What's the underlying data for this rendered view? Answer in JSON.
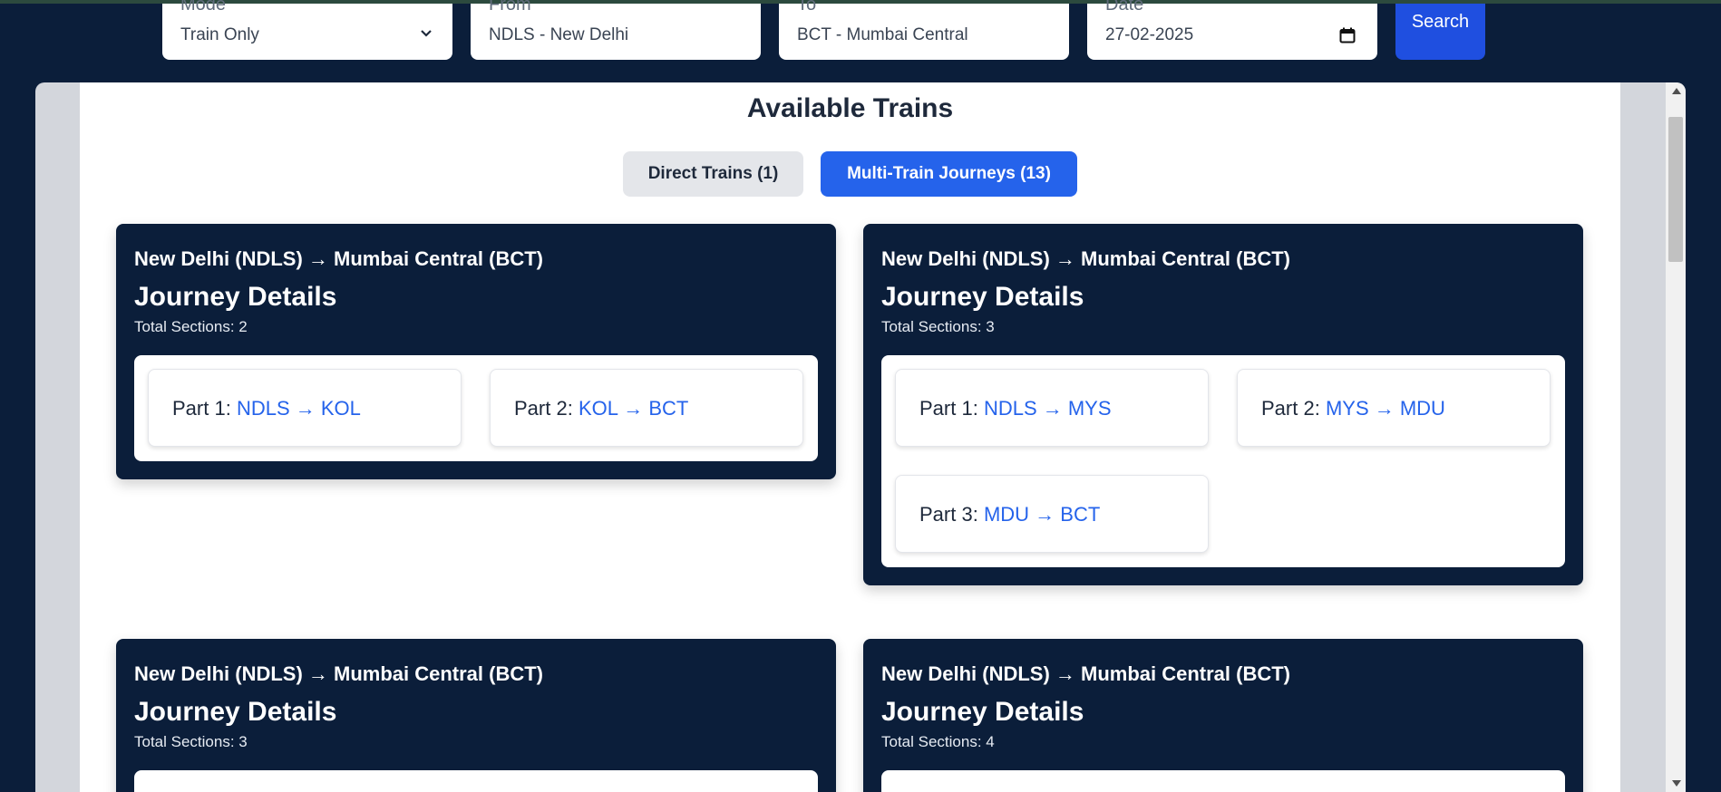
{
  "search": {
    "mode": {
      "label": "Mode",
      "value": "Train Only"
    },
    "from": {
      "label": "From",
      "value": "NDLS - New Delhi"
    },
    "to": {
      "label": "To",
      "value": "BCT - Mumbai Central"
    },
    "date": {
      "label": "Date",
      "value": "27-02-2025"
    },
    "button": "Search"
  },
  "page": {
    "heading": "Available Trains",
    "tabs": [
      {
        "label": "Direct Trains (1)",
        "active": false
      },
      {
        "label": "Multi-Train Journeys (13)",
        "active": true
      }
    ]
  },
  "journeys": [
    {
      "route": "New Delhi (NDLS) → Mumbai Central (BCT)",
      "title": "Journey Details",
      "sections": "Total Sections: 2",
      "parts": [
        {
          "label": "Part 1:",
          "route": "NDLS → KOL"
        },
        {
          "label": "Part 2:",
          "route": "KOL → BCT"
        }
      ]
    },
    {
      "route": "New Delhi (NDLS) → Mumbai Central (BCT)",
      "title": "Journey Details",
      "sections": "Total Sections: 3",
      "parts": [
        {
          "label": "Part 1:",
          "route": "NDLS → MYS"
        },
        {
          "label": "Part 2:",
          "route": "MYS → MDU"
        },
        {
          "label": "Part 3:",
          "route": "MDU → BCT"
        }
      ]
    },
    {
      "route": "New Delhi (NDLS) → Mumbai Central (BCT)",
      "title": "Journey Details",
      "sections": "Total Sections: 3"
    },
    {
      "route": "New Delhi (NDLS) → Mumbai Central (BCT)",
      "title": "Journey Details",
      "sections": "Total Sections: 4"
    }
  ],
  "icons": {
    "mode_dropdown": "chevron-down-icon",
    "date_picker": "calendar-icon"
  }
}
